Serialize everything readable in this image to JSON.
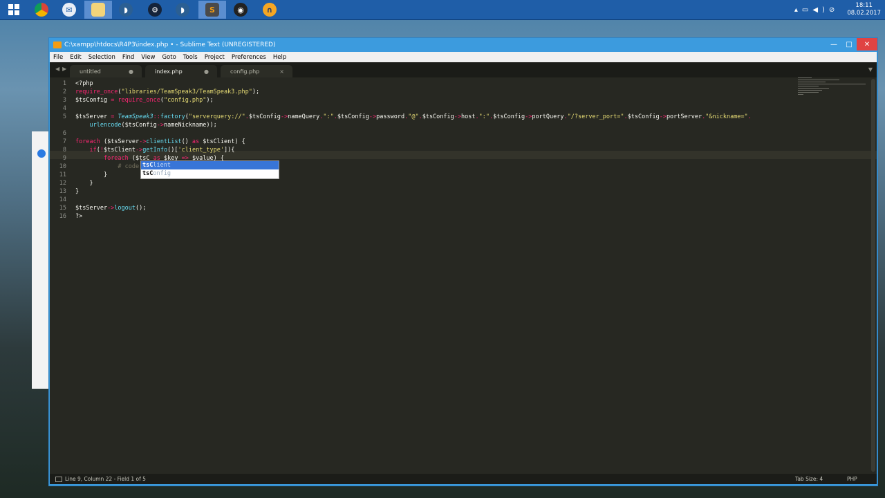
{
  "taskbar": {
    "apps": [
      {
        "name": "Google Chrome",
        "icon": "chrome-icon"
      },
      {
        "name": "Thunderbird",
        "icon": "thunderbird-icon"
      },
      {
        "name": "File Explorer",
        "icon": "folder-icon"
      },
      {
        "name": "TeamSpeak 3",
        "icon": "teamspeak-icon"
      },
      {
        "name": "Steam",
        "icon": "steam-icon"
      },
      {
        "name": "TeamSpeak 3",
        "icon": "teamspeak-icon"
      },
      {
        "name": "Sublime Text",
        "icon": "sublime-icon"
      },
      {
        "name": "OBS Studio",
        "icon": "obs-icon"
      },
      {
        "name": "Headset App",
        "icon": "headset-icon"
      }
    ],
    "clock_time": "18:11",
    "clock_date": "08.02.2017"
  },
  "window": {
    "title": "C:\\xampp\\htdocs\\R4P3\\index.php • - Sublime Text (UNREGISTERED)"
  },
  "menu": [
    "File",
    "Edit",
    "Selection",
    "Find",
    "View",
    "Goto",
    "Tools",
    "Project",
    "Preferences",
    "Help"
  ],
  "tabs": [
    {
      "label": "untitled",
      "mark": "●"
    },
    {
      "label": "index.php",
      "mark": "●"
    },
    {
      "label": "config.php",
      "mark": "×"
    }
  ],
  "editor": {
    "line_numbers": [
      "1",
      "2",
      "3",
      "4",
      "5",
      "",
      "6",
      "7",
      "8",
      "9",
      "10",
      "11",
      "12",
      "13",
      "14",
      "15",
      "16"
    ],
    "autocomplete": {
      "typed": "tsC",
      "items": [
        "lient",
        "onfig"
      ]
    }
  },
  "status": {
    "position": "Line 9, Column 22 - Field 1 of 5",
    "tab_size": "Tab Size: 4",
    "syntax": "PHP"
  },
  "colors": {
    "editor_bg": "#272822",
    "keyword": "#f92672",
    "string": "#e6db74",
    "function": "#66d9ef",
    "comment": "#75715e",
    "titlebar": "#3c9bde",
    "taskbar": "#1f5ea8"
  }
}
